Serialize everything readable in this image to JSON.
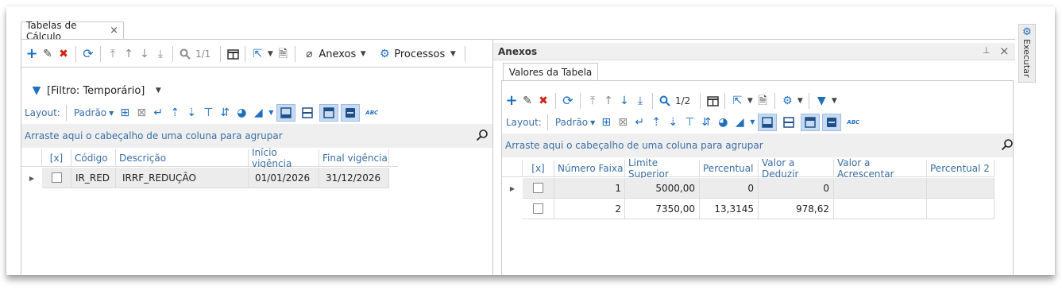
{
  "document_tab": {
    "label": "Tabelas de Cálculo",
    "close": "×"
  },
  "left_toolbar": {
    "page_counter": "1/1",
    "anexos_label": "Anexos",
    "processos_label": "Processos"
  },
  "filter": {
    "label": "[Filtro: Temporário]"
  },
  "layout_bar": {
    "layout_label": "Layout:",
    "preset_label": "Padrão",
    "abc": "ABC"
  },
  "left_group_hint": "Arraste aqui o cabeçalho de uma coluna para agrupar",
  "left_grid": {
    "columns": [
      "[x]",
      "Código",
      "Descrição",
      "Início vigência",
      "Final vigência"
    ],
    "rows": [
      {
        "codigo": "IR_RED",
        "descricao": "IRRF_REDUÇÃO",
        "inicio": "01/01/2026",
        "final": "31/12/2026"
      }
    ]
  },
  "annex_panel": {
    "title": "Anexos",
    "pin": "⊥",
    "close": "×",
    "tab_label": "Valores da Tabela",
    "page_counter": "1/2",
    "layout_label": "Layout:",
    "preset_label": "Padrão",
    "abc": "ABC",
    "group_hint": "Arraste aqui o cabeçalho de uma coluna para agrupar",
    "columns": [
      "[x]",
      "Número Faixa",
      "Limite Superior",
      "Percentual",
      "Valor a Deduzir",
      "Valor a Acrescentar",
      "Percentual 2"
    ],
    "rows": [
      {
        "numero": "1",
        "limite": "5000,00",
        "percentual": "0",
        "deduzir": "0",
        "acrescentar": "",
        "percentual2": ""
      },
      {
        "numero": "2",
        "limite": "7350,00",
        "percentual": "13,3145",
        "deduzir": "978,62",
        "acrescentar": "",
        "percentual2": ""
      }
    ]
  },
  "side_panel": {
    "label": "Executar"
  },
  "colors": {
    "accent_blue": "#1f6fbf",
    "delete_red": "#d0241b",
    "header_blue": "#3a6ea5",
    "selected_row": "#ececec",
    "toggle_bg": "#c6dbf2"
  }
}
